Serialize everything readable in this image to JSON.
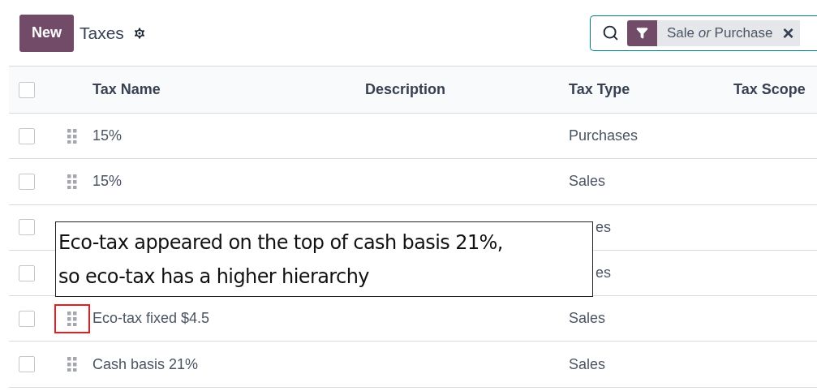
{
  "header": {
    "new_button": "New",
    "title": "Taxes"
  },
  "search": {
    "facet": "Sale *or* Purchase",
    "remove": "×"
  },
  "table": {
    "all_checked": false,
    "columns": [
      "Tax Name",
      "Description",
      "Tax Type",
      "Tax Scope"
    ],
    "rows": [
      {
        "name": "15%",
        "tax_type": "Purchases",
        "checked": false
      },
      {
        "name": "15%",
        "tax_type": "Sales",
        "checked": false
      },
      {
        "tax_type": "es",
        "checked": false
      },
      {
        "tax_type": "es",
        "checked": false
      },
      {
        "name": "Eco-tax fixed $4.5",
        "tax_type": "Sales",
        "checked": false,
        "highlighted": true
      },
      {
        "name": "Cash basis 21%",
        "tax_type": "Sales",
        "checked": false
      }
    ]
  },
  "annotation": {
    "lines": [
      "Eco-tax appeared on the top of cash basis 21%,",
      "so eco-tax has a higher hierarchy"
    ]
  }
}
